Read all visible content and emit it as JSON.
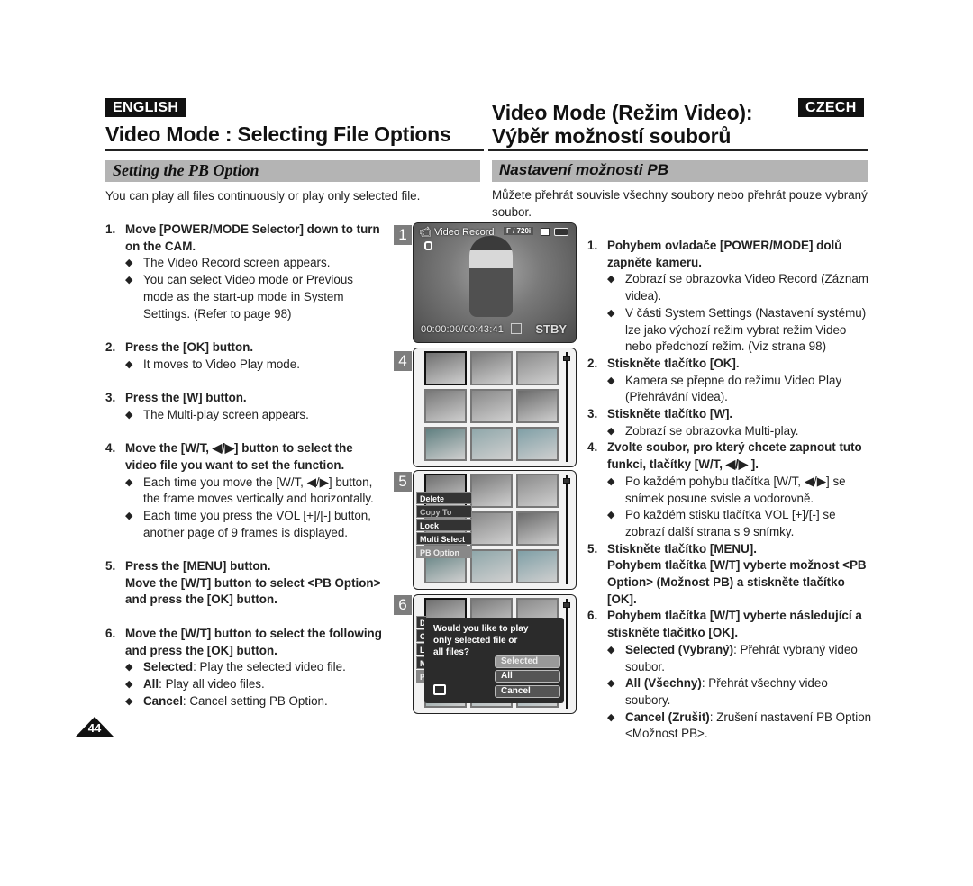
{
  "english": {
    "language_badge": "ENGLISH",
    "title": "Video Mode : Selecting File Options",
    "section_title": "Setting the PB Option",
    "intro": "You can play all files continuously or play only selected file.",
    "steps": [
      {
        "num": "1.",
        "head": [
          "Move [POWER/MODE Selector] down to turn",
          "on the CAM."
        ],
        "bullets": [
          [
            "The Video Record screen appears."
          ],
          [
            "You can select Video mode or Previous",
            "mode as the start-up mode in System",
            "Settings. (Refer to page 98)"
          ]
        ]
      },
      {
        "num": "2.",
        "head": [
          "Press the [OK] button."
        ],
        "bullets": [
          [
            "It moves to Video Play mode."
          ]
        ]
      },
      {
        "num": "3.",
        "head": [
          "Press the [W] button."
        ],
        "bullets": [
          [
            "The Multi-play screen appears."
          ]
        ]
      },
      {
        "num": "4.",
        "head": [
          "Move the [W/T, ◀/▶] button to select the",
          "video file you want to set the function."
        ],
        "bullets": [
          [
            "Each time you move the [W/T, ◀/▶] button,",
            "the frame moves vertically and horizontally."
          ],
          [
            "Each time you press the VOL [+]/[-] button,",
            "another page of 9 frames is displayed."
          ]
        ]
      },
      {
        "num": "5.",
        "head": [
          "Press the [MENU] button.",
          "Move the [W/T] button to select <PB Option>",
          "and press the [OK] button."
        ],
        "bullets": []
      },
      {
        "num": "6.",
        "head": [
          "Move the [W/T] button to select the following",
          "and press the [OK] button."
        ],
        "options": [
          {
            "term": "Selected",
            "desc": ": Play the selected video file."
          },
          {
            "term": "All",
            "desc": ": Play all video files."
          },
          {
            "term": "Cancel",
            "desc": ": Cancel setting PB Option."
          }
        ]
      }
    ]
  },
  "czech": {
    "language_badge": "CZECH",
    "title_line1": "Video Mode (Režim Video):",
    "title_line2": "Výběr možností souborů",
    "section_title": "Nastavení možnosti PB",
    "intro_line1": "Můžete přehrát souvisle všechny soubory nebo přehrát pouze vybraný",
    "intro_line2": "soubor.",
    "steps": [
      {
        "num": "1.",
        "head": [
          "Pohybem ovladače [POWER/MODE] dolů",
          "zapněte kameru."
        ],
        "bullets": [
          [
            "Zobrazí se obrazovka Video Record (Záznam",
            "videa)."
          ],
          [
            "V části System Settings (Nastavení systému)",
            "lze jako výchozí režim vybrat režim Video",
            "nebo předchozí režim. (Viz strana 98)"
          ]
        ]
      },
      {
        "num": "2.",
        "head": [
          "Stiskněte tlačítko [OK]."
        ],
        "bullets": [
          [
            "Kamera se přepne do režimu Video Play",
            "(Přehrávání videa)."
          ]
        ]
      },
      {
        "num": "3.",
        "head": [
          "Stiskněte tlačítko [W]."
        ],
        "bullets": [
          [
            "Zobrazí se obrazovka Multi-play."
          ]
        ]
      },
      {
        "num": "4.",
        "head": [
          "Zvolte soubor, pro který chcete zapnout tuto",
          "funkci, tlačítky [W/T, ◀/▶ ]."
        ],
        "bullets": [
          [
            "Po každém pohybu tlačítka [W/T, ◀/▶] se",
            "snímek posune svisle a vodorovně."
          ],
          [
            "Po každém stisku tlačítka VOL [+]/[-] se",
            "zobrazí další strana s 9 snímky."
          ]
        ]
      },
      {
        "num": "5.",
        "head": [
          "Stiskněte tlačítko [MENU].",
          "Pohybem tlačítka [W/T] vyberte možnost <PB",
          "Option> (Možnost PB) a stiskněte tlačítko [OK]."
        ],
        "bullets": []
      },
      {
        "num": "6.",
        "head": [
          "Pohybem tlačítka [W/T] vyberte následující a",
          "stiskněte tlačítko [OK]."
        ],
        "options": [
          {
            "term": "Selected (Vybraný)",
            "desc": ": Přehrát vybraný video",
            "desc2": "soubor."
          },
          {
            "term": "All (Všechny)",
            "desc": ": Přehrát všechny video soubory."
          },
          {
            "term": "Cancel (Zrušit)",
            "desc": ": Zrušení nastavení PB Option",
            "desc2": "<Možnost PB>."
          }
        ]
      }
    ]
  },
  "screens": {
    "s1": {
      "number": "1",
      "mode_label": "Video Record",
      "quality_badge": "F / 720i",
      "timecode": "00:00:00/00:43:41",
      "status": "STBY",
      "icons": [
        "video-camera-icon",
        "memory-icon",
        "battery-icon",
        "hand-stabilizer-icon"
      ]
    },
    "s4": {
      "number": "4",
      "thumbnail_count": 9,
      "selected_index": 0
    },
    "s5": {
      "number": "5",
      "menu": [
        {
          "label": "Delete",
          "state": "normal"
        },
        {
          "label": "Copy To",
          "state": "disabled"
        },
        {
          "label": "Lock",
          "state": "normal"
        },
        {
          "label": "Multi Select",
          "state": "normal"
        },
        {
          "label": "PB Option",
          "state": "highlighted"
        }
      ]
    },
    "s6": {
      "number": "6",
      "menu_letters": [
        "D",
        "C",
        "L",
        "M",
        "P"
      ],
      "dialog_text": [
        "Would you like to play",
        "only selected file or",
        "all files?"
      ],
      "buttons": [
        {
          "label": "Selected",
          "active": true
        },
        {
          "label": "All",
          "active": false
        },
        {
          "label": "Cancel",
          "active": false
        }
      ]
    }
  },
  "page_number": "44",
  "colors": {
    "badge_bg": "#111111",
    "section_bar": "#b4b4b4",
    "screen_number_bg": "#7d7d7d"
  }
}
